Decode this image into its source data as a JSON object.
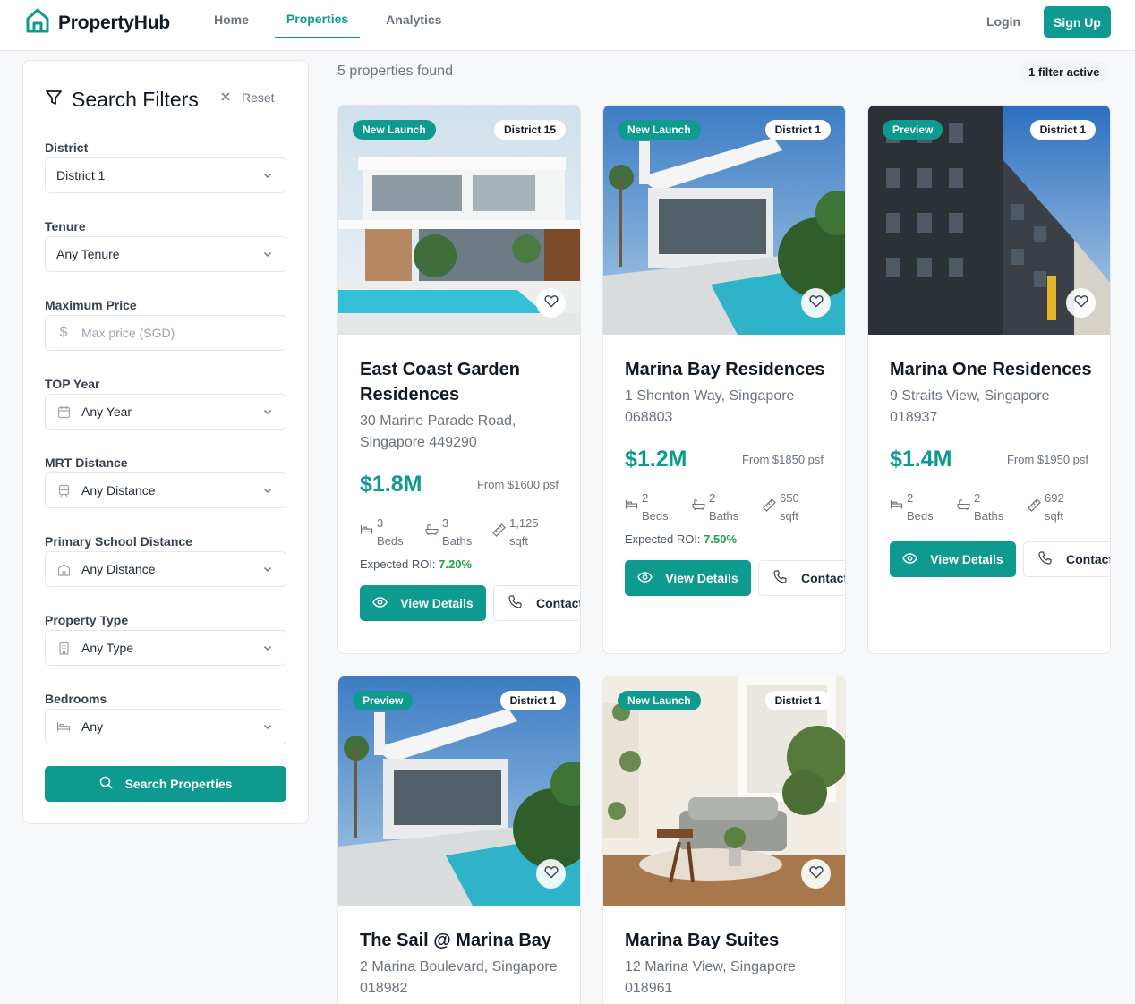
{
  "app": {
    "name": "PropertyHub"
  },
  "nav": {
    "items": [
      "Home",
      "Properties",
      "Analytics"
    ],
    "active": "Properties"
  },
  "auth": {
    "login": "Login",
    "signup": "Sign Up"
  },
  "colors": {
    "brand": "#0f9a8f",
    "roi": "#22a04a"
  },
  "filters": {
    "title": "Search Filters",
    "reset": "Reset",
    "fields": [
      {
        "label": "District",
        "value": "District 1",
        "icon": "none"
      },
      {
        "label": "Tenure",
        "value": "Any Tenure",
        "icon": "none"
      },
      {
        "label": "Maximum Price",
        "placeholder": "Max price (SGD)",
        "icon": "dollar-icon"
      },
      {
        "label": "TOP Year",
        "value": "Any Year",
        "icon": "calendar-icon"
      },
      {
        "label": "MRT Distance",
        "value": "Any Distance",
        "icon": "train-icon"
      },
      {
        "label": "Primary School Distance",
        "value": "Any Distance",
        "icon": "school-icon"
      },
      {
        "label": "Property Type",
        "value": "Any Type",
        "icon": "building-icon"
      },
      {
        "label": "Bedrooms",
        "value": "Any",
        "icon": "bed-icon"
      }
    ],
    "search_button": "Search Properties"
  },
  "results": {
    "count_text": "5 properties found",
    "filter_badge": "1 filter active"
  },
  "properties": [
    {
      "badge": "New Launch",
      "district": "District 15",
      "title": "East Coast Garden Residences",
      "address": "30 Marine Parade Road, Singapore 449290",
      "price": "$1.8M",
      "psf": "From $1600 psf",
      "beds": "3",
      "beds_label": "Beds",
      "baths": "3",
      "baths_label": "Baths",
      "area": "1,125",
      "area_label": "sqft",
      "roi_label": "Expected ROI: ",
      "roi": "7.20%",
      "view": "View Details",
      "contact": "Contact"
    },
    {
      "badge": "New Launch",
      "district": "District 1",
      "title": "Marina Bay Residences",
      "address": "1 Shenton Way, Singapore 068803",
      "price": "$1.2M",
      "psf": "From $1850 psf",
      "beds": "2",
      "beds_label": "Beds",
      "baths": "2",
      "baths_label": "Baths",
      "area": "650",
      "area_label": "sqft",
      "roi_label": "Expected ROI: ",
      "roi": "7.50%",
      "view": "View Details",
      "contact": "Contact"
    },
    {
      "badge": "Preview",
      "district": "District 1",
      "title": "Marina One Residences",
      "address": "9 Straits View, Singapore 018937",
      "price": "$1.4M",
      "psf": "From $1950 psf",
      "beds": "2",
      "beds_label": "Beds",
      "baths": "2",
      "baths_label": "Baths",
      "area": "692",
      "area_label": "sqft",
      "view": "View Details",
      "contact": "Contact"
    },
    {
      "badge": "Preview",
      "district": "District 1",
      "title": "The Sail @ Marina Bay",
      "address": "2 Marina Boulevard, Singapore 018982"
    },
    {
      "badge": "New Launch",
      "district": "District 1",
      "title": "Marina Bay Suites",
      "address": "12 Marina View, Singapore 018961"
    }
  ]
}
